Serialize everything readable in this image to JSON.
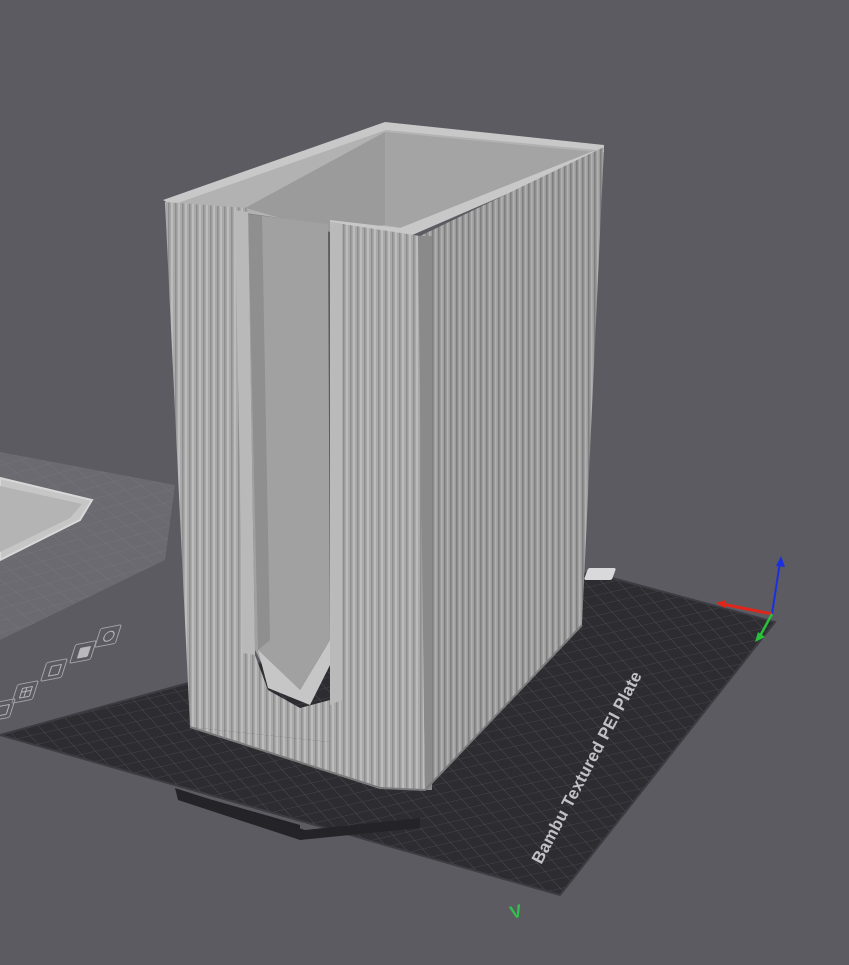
{
  "viewport": {
    "app": "3D slicer preview",
    "background": "#5b5b61"
  },
  "build_plate": {
    "label": "Bambu Textured PEI Plate",
    "surface_color": "#2c2c31",
    "grid_color": "#55555b"
  },
  "model": {
    "name": "fluted box with front slot",
    "color": "#a9a9a9"
  },
  "axes": {
    "x_color": "#e0261b",
    "y_color": "#29c13b",
    "z_color": "#1b2fe0",
    "origin_marker": "V"
  },
  "plate_toolbar": {
    "icons": [
      "settings-icon",
      "lock-icon",
      "arrange-icon",
      "orient-icon",
      "grid-icon",
      "select-icon"
    ]
  }
}
